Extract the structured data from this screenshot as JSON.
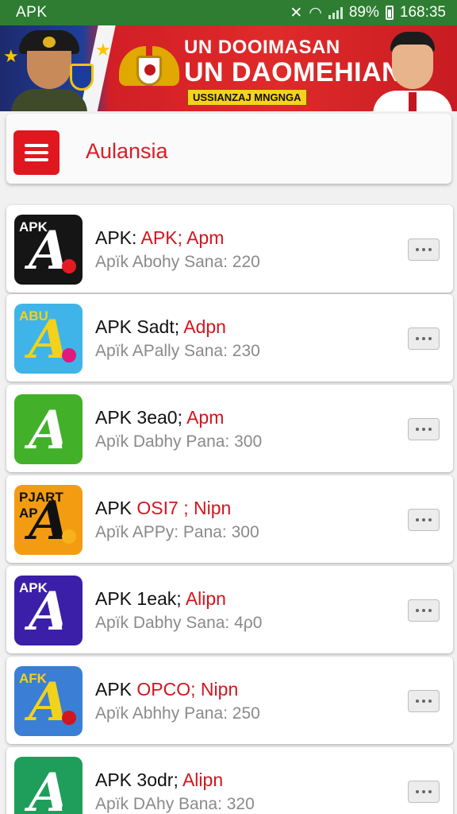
{
  "status_bar": {
    "app": "APK",
    "battery": "89%",
    "time": "168:35"
  },
  "banner": {
    "line1": "UN DOOIMASAN",
    "line2": "UN DAOMEHIAN",
    "tagline": "USSIANZAJ MNGNGA"
  },
  "header": {
    "title": "Aulansia"
  },
  "apps": [
    {
      "name": "APK: ",
      "name_red": "APK; Apm",
      "subtitle": "Apïk Abohy Sana: 220",
      "icon_label": "APK",
      "icon_bg": "#151515",
      "icon_fg": "#ffffff",
      "icon_dot": "#e41b23"
    },
    {
      "name": "APK Sadt; ",
      "name_red": "Adpn",
      "subtitle": "Apïk APally Sana: 230",
      "icon_label": "ABU",
      "icon_bg": "#3fb4e8",
      "icon_fg": "#f2d21b",
      "icon_dot": "#e0197d"
    },
    {
      "name": "APK 3ea0; ",
      "name_red": "Apm",
      "subtitle": "Apïk Dabhy Pana: 300",
      "icon_label": "",
      "icon_bg": "#43b02a",
      "icon_fg": "#ffffff",
      "icon_dot": "#43b02a"
    },
    {
      "name": "APK ",
      "name_red": "OSI7 ; Nipn",
      "subtitle": "Apïk APPy: Pana: 300",
      "icon_label": "PJART AP",
      "icon_bg": "#f39c12",
      "icon_fg": "#111111",
      "icon_dot": "#f7b21b"
    },
    {
      "name": "APK 1eak; ",
      "name_red": "Alipn",
      "subtitle": "Apïk Dabhy Sana: 4ρ0",
      "icon_label": "APK",
      "icon_bg": "#3b1fa8",
      "icon_fg": "#ffffff",
      "icon_dot": "#3b1fa8"
    },
    {
      "name": "APK ",
      "name_red": "OPCO; Nipn",
      "subtitle": "Apïk Abhhy Pana: 250",
      "icon_label": "AFK",
      "icon_bg": "#3a7fd5",
      "icon_fg": "#f2d21b",
      "icon_dot": "#d2151e"
    },
    {
      "name": "APK 3odr; ",
      "name_red": "Alipn",
      "subtitle": "Apïk DAhy Bana: 320",
      "icon_label": "",
      "icon_bg": "#1e9e5a",
      "icon_fg": "#ffffff",
      "icon_dot": "#1e9e5a"
    }
  ]
}
